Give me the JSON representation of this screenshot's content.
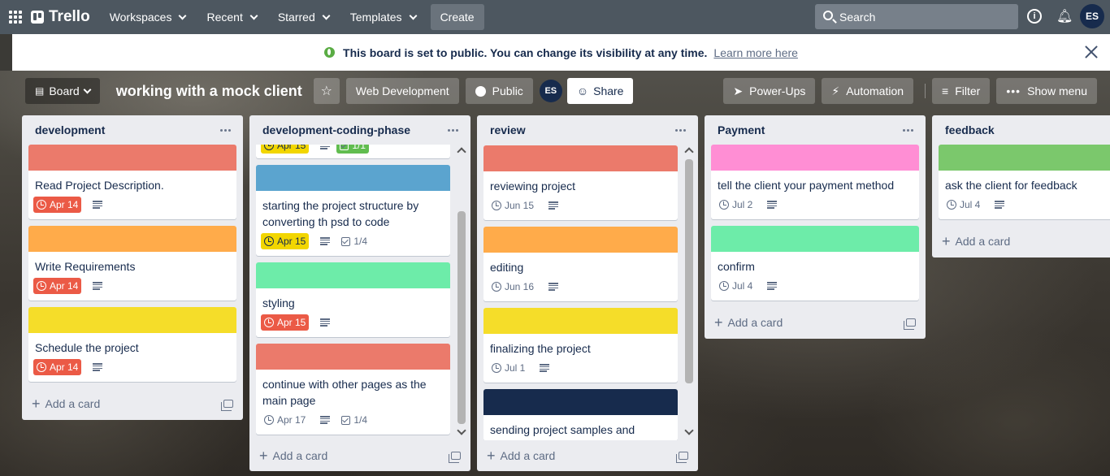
{
  "nav": {
    "brand": "Trello",
    "menus": [
      "Workspaces",
      "Recent",
      "Starred",
      "Templates"
    ],
    "create": "Create",
    "search_placeholder": "Search",
    "avatar": "ES"
  },
  "banner": {
    "text": "This board is set to public. You can change its visibility at any time.",
    "link": "Learn more here"
  },
  "board": {
    "view": "Board",
    "title": "working with a mock client",
    "workspace": "Web Development",
    "visibility": "Public",
    "member": "ES",
    "share": "Share",
    "power_ups": "Power-Ups",
    "automation": "Automation",
    "filter": "Filter",
    "show_menu": "Show menu"
  },
  "add_card_label": "Add a card",
  "lists": [
    {
      "title": "development",
      "cards": [
        {
          "cover": "#eb7a6b",
          "title": "Read Project Description.",
          "due": "Apr 14",
          "due_style": "red",
          "desc": true
        },
        {
          "cover": "#ffab4a",
          "title": "Write Requirements",
          "due": "Apr 14",
          "due_style": "red",
          "desc": true
        },
        {
          "cover": "#f5dd29",
          "title": "Schedule the project",
          "due": "Apr 14",
          "due_style": "red",
          "desc": true
        }
      ]
    },
    {
      "title": "development-coding-phase",
      "partial_top": {
        "due": "Apr 15",
        "check": "1/1"
      },
      "cards": [
        {
          "cover": "#5ba4cf",
          "title": "starting the project structure by converting th psd to code",
          "due": "Apr 15",
          "due_style": "yellow",
          "desc": true,
          "check": "1/4"
        },
        {
          "cover": "#6deca9",
          "title": "styling",
          "due": "Apr 15",
          "due_style": "red",
          "desc": true
        },
        {
          "cover": "#eb7a6b",
          "title": "continue with other pages as the main page",
          "due": "Apr 17",
          "due_style": "plain",
          "desc": true,
          "check": "1/4"
        }
      ]
    },
    {
      "title": "review",
      "cards": [
        {
          "cover": "#eb7a6b",
          "title": "reviewing project",
          "due": "Jun 15",
          "due_style": "plain",
          "desc": true
        },
        {
          "cover": "#ffab4a",
          "title": "editing",
          "due": "Jun 16",
          "due_style": "plain",
          "desc": true
        },
        {
          "cover": "#f5dd29",
          "title": "finalizing the project",
          "due": "Jul 1",
          "due_style": "plain",
          "desc": true
        },
        {
          "cover": "#172b4d",
          "title": "sending project samples and",
          "due": "",
          "due_style": "none",
          "desc": false
        }
      ]
    },
    {
      "title": "Payment",
      "cards": [
        {
          "cover": "#ff8ed4",
          "title": "tell the client your payment method",
          "due": "Jul 2",
          "due_style": "plain",
          "desc": true
        },
        {
          "cover": "#6deca9",
          "title": "confirm",
          "due": "Jul 4",
          "due_style": "plain",
          "desc": true
        }
      ]
    },
    {
      "title": "feedback",
      "cards": [
        {
          "cover": "#7bc86c",
          "title": "ask the client for feedback",
          "due": "Jul 4",
          "due_style": "plain",
          "desc": true
        }
      ]
    }
  ]
}
